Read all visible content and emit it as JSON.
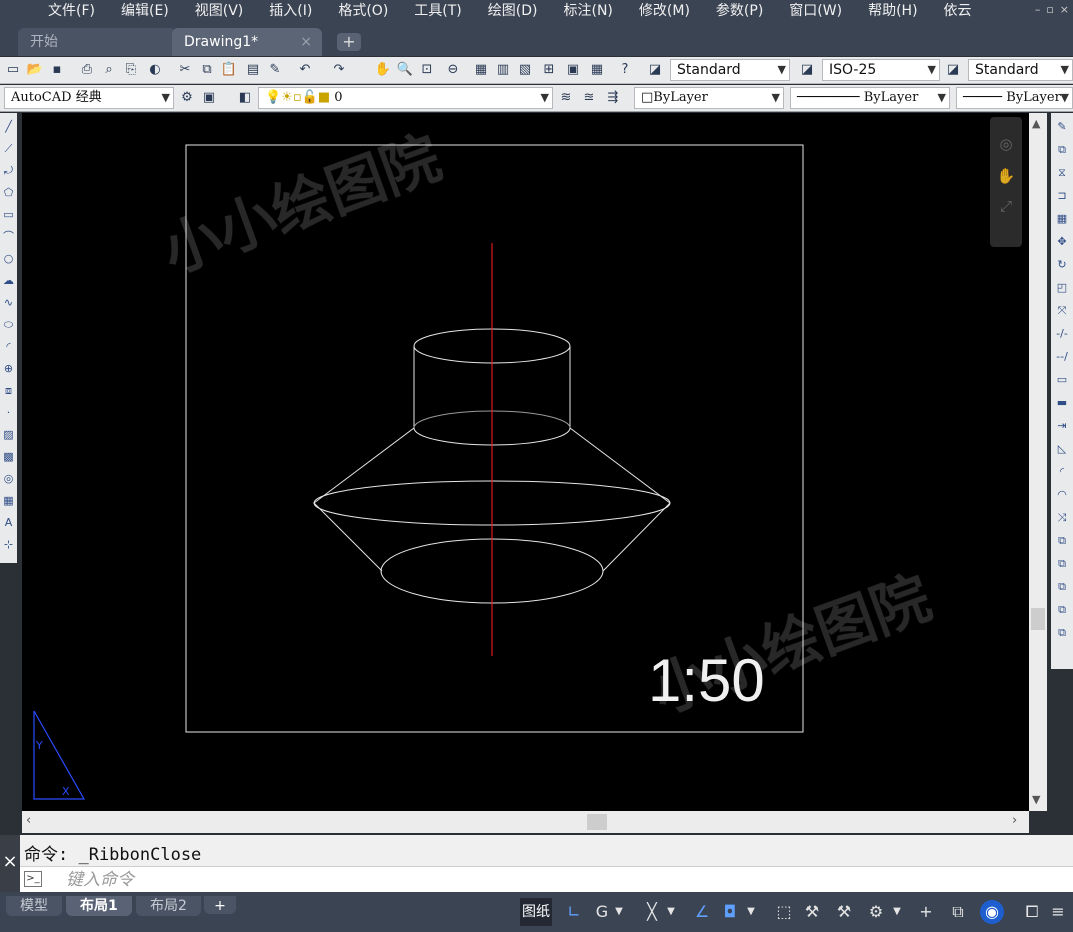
{
  "menu": [
    "文件(F)",
    "编辑(E)",
    "视图(V)",
    "插入(I)",
    "格式(O)",
    "工具(T)",
    "绘图(D)",
    "标注(N)",
    "修改(M)",
    "参数(P)",
    "窗口(W)",
    "帮助(H)",
    "依云"
  ],
  "window_controls": [
    "–",
    "▫",
    "×"
  ],
  "doc_tabs": {
    "start": "开始",
    "drawing": "Drawing1*",
    "close": "×",
    "add": "+"
  },
  "toolbar1": {
    "text_style": "Standard",
    "dim_style": "ISO-25",
    "table_style": "Standard"
  },
  "toolbar2": {
    "workspace": "AutoCAD 经典",
    "layer": "0",
    "color": "ByLayer",
    "linetype": "ByLayer",
    "lineweight": "ByLayer"
  },
  "drawing": {
    "watermark": "小小绘图院",
    "scale_label": "1:50",
    "ucs_y": "Y",
    "ucs_x": "X"
  },
  "command": {
    "history": "命令:  _RibbonClose",
    "placeholder": "键入命令",
    "grip_label": "×"
  },
  "layout_tabs": {
    "model": "模型",
    "layout1": "布局1",
    "layout2": "布局2",
    "add": "+"
  },
  "status": {
    "paper": "图纸"
  },
  "colors": {
    "canvas": "#000000",
    "axis_line": "#ff2020",
    "geometry": "#e6e6e6",
    "menubar": "#3b4453",
    "accent": "#5fa0ff"
  },
  "icons": {
    "toolbar1": [
      "new-icon",
      "open-icon",
      "save-icon",
      "print-icon",
      "print-preview-icon",
      "publish-icon",
      "3d-print-icon",
      "cut-icon",
      "copy-icon",
      "paste-icon",
      "paste-block-icon",
      "match-properties-icon",
      "undo-icon",
      "redo-icon",
      "pan-icon",
      "zoom-realtime-icon",
      "zoom-window-icon",
      "zoom-previous-icon",
      "properties-icon",
      "design-center-icon",
      "tool-palettes-icon",
      "sheet-set-icon",
      "markup-icon",
      "calculator-icon",
      "help-icon"
    ],
    "left": [
      "line-icon",
      "construction-line-icon",
      "polyline-icon",
      "polygon-icon",
      "rectangle-icon",
      "arc-icon",
      "circle-icon",
      "revision-cloud-icon",
      "spline-icon",
      "ellipse-icon",
      "ellipse-arc-icon",
      "insert-block-icon",
      "make-block-icon",
      "point-icon",
      "hatch-icon",
      "gradient-icon",
      "region-icon",
      "table-icon",
      "mtext-icon",
      "add-selected-icon"
    ],
    "right": [
      "erase-icon",
      "copy-object-icon",
      "mirror-icon",
      "offset-icon",
      "array-icon",
      "move-icon",
      "rotate-icon",
      "scale-icon",
      "stretch-icon",
      "trim-icon",
      "extend-icon",
      "break-at-point-icon",
      "break-icon",
      "join-icon",
      "chamfer-icon",
      "fillet-icon",
      "blend-icon",
      "explode-icon",
      "draw-order-icon",
      "bring-front-icon",
      "send-back-icon",
      "text-front-icon",
      "hatch-back-icon"
    ]
  }
}
